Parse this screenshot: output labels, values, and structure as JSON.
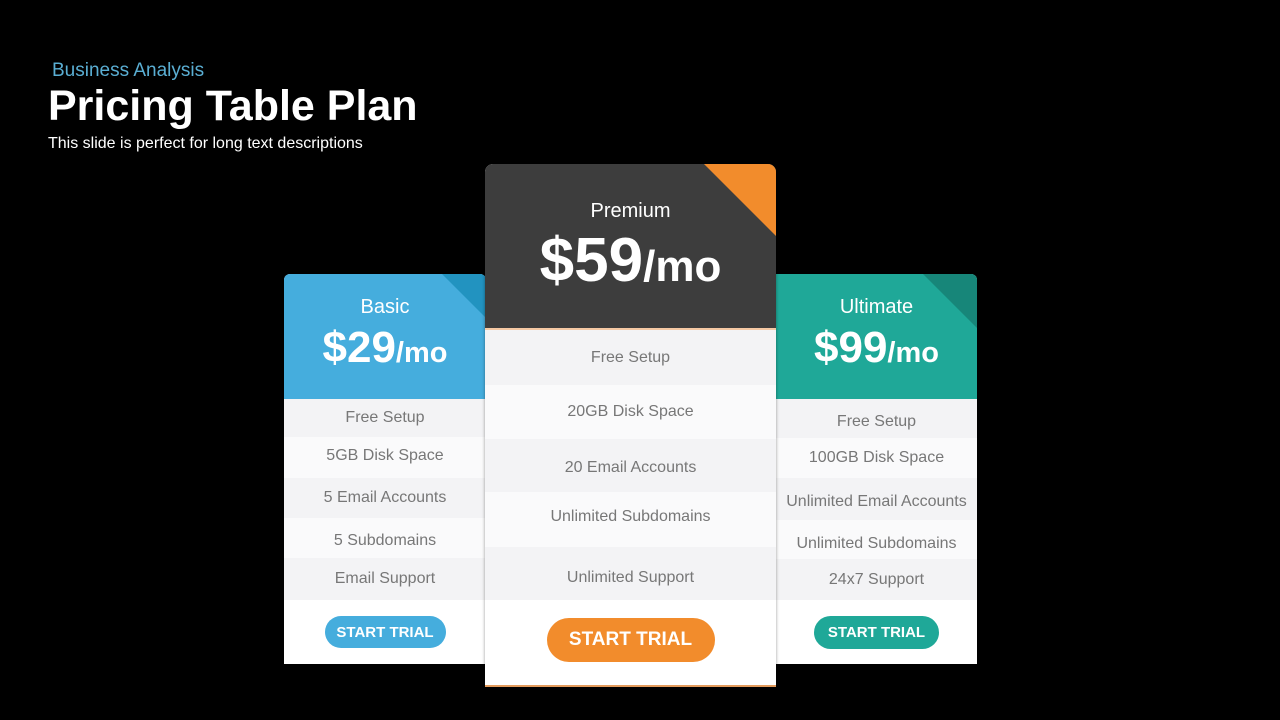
{
  "header": {
    "kicker": "Business Analysis",
    "title": "Pricing Table Plan",
    "description": "This slide is perfect for long text descriptions"
  },
  "colors": {
    "basic": "#45addd",
    "premium_header": "#3d3d3d",
    "premium_accent": "#f28c2c",
    "ultimate": "#1fa898",
    "background": "#000000"
  },
  "plans": [
    {
      "name": "Basic",
      "price": "$29",
      "unit": "/mo",
      "features": [
        "Free Setup",
        "5GB Disk Space",
        "5 Email Accounts",
        "5 Subdomains",
        "Email Support"
      ],
      "button_label": "START TRIAL"
    },
    {
      "name": "Premium",
      "price": "$59",
      "unit": "/mo",
      "features": [
        "Free Setup",
        "20GB Disk Space",
        "20 Email Accounts",
        "Unlimited Subdomains",
        "Unlimited Support"
      ],
      "button_label": "START TRIAL"
    },
    {
      "name": "Ultimate",
      "price": "$99",
      "unit": "/mo",
      "features": [
        "Free Setup",
        "100GB Disk Space",
        "Unlimited Email Accounts",
        "Unlimited Subdomains",
        "24x7 Support"
      ],
      "button_label": "START TRIAL"
    }
  ]
}
